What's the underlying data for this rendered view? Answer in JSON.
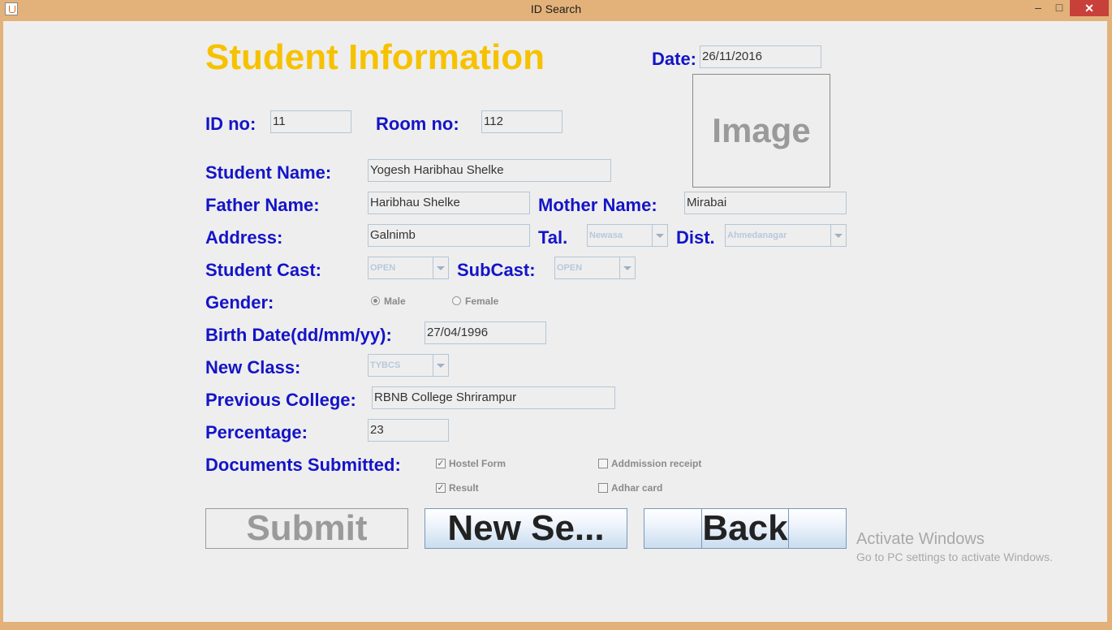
{
  "window": {
    "title": "ID Search",
    "controls": {
      "minimize": "‒",
      "maximize": "□",
      "close": "✕"
    }
  },
  "form": {
    "heading": "Student Information",
    "date_label": "Date:",
    "date_value": "26/11/2016",
    "image_placeholder": "Image",
    "id_label": "ID no:",
    "id_value": "11",
    "room_label": "Room no:",
    "room_value": "112",
    "student_name_label": "Student Name:",
    "student_name_value": "Yogesh Haribhau Shelke",
    "father_name_label": "Father Name:",
    "father_name_value": "Haribhau Shelke",
    "mother_name_label": "Mother Name:",
    "mother_name_value": "Mirabai",
    "address_label": "Address:",
    "address_value": "Galnimb",
    "tal_label": "Tal.",
    "tal_value": "Newasa",
    "dist_label": "Dist.",
    "dist_value": "Ahmedanagar",
    "cast_label": "Student Cast:",
    "cast_value": "OPEN",
    "subcast_label": "SubCast:",
    "subcast_value": "OPEN",
    "gender_label": "Gender:",
    "gender_options": [
      {
        "label": "Male",
        "selected": true
      },
      {
        "label": "Female",
        "selected": false
      }
    ],
    "birth_label": "Birth Date(dd/mm/yy):",
    "birth_value": "27/04/1996",
    "class_label": "New Class:",
    "class_value": "TYBCS",
    "college_label": "Previous College:",
    "college_value": "RBNB College Shrirampur",
    "percentage_label": "Percentage:",
    "percentage_value": "23",
    "documents_label": "Documents Submitted:",
    "documents": [
      {
        "label": "Hostel Form",
        "checked": true
      },
      {
        "label": "Addmission receipt",
        "checked": false
      },
      {
        "label": "Result",
        "checked": true
      },
      {
        "label": "Adhar card",
        "checked": false
      }
    ]
  },
  "buttons": {
    "submit": "Submit",
    "new_search": "New Se...",
    "back": "Back"
  },
  "watermark": {
    "line1": "Activate Windows",
    "line2": "Go to PC settings to activate Windows."
  },
  "colors": {
    "heading": "#f6c200",
    "label": "#1414c8",
    "titlebar": "#e3b27a",
    "close_button": "#c7413a",
    "background": "#eeeeee"
  },
  "icons": {
    "app": "java-cup-icon",
    "minimize": "minimize-icon",
    "maximize": "maximize-icon",
    "close": "close-icon"
  }
}
